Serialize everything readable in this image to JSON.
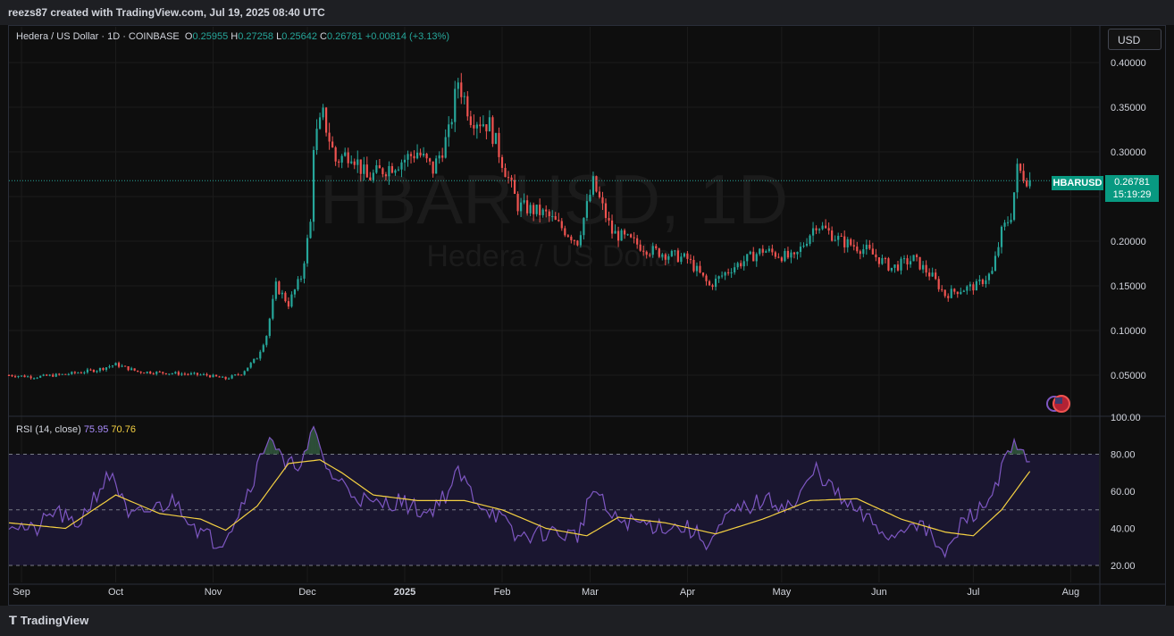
{
  "header": {
    "credit": "reezs87 created with TradingView.com, Jul 19, 2025 08:40 UTC"
  },
  "legend": {
    "title": "Hedera / US Dollar · 1D · COINBASE",
    "o_label": "O",
    "o": "0.25955",
    "h_label": "H",
    "h": "0.27258",
    "l_label": "L",
    "l": "0.25642",
    "c_label": "C",
    "c": "0.26781",
    "change": "+0.00814 (+3.13%)"
  },
  "currency_button": "USD",
  "watermark": {
    "symbol": "HBARUSD, 1D",
    "name": "Hedera / US Dollar"
  },
  "price_tag": {
    "symbol": "HBARUSD",
    "price": "0.26781",
    "countdown": "15:19:29"
  },
  "rsi_legend": {
    "label": "RSI (14, close)",
    "rsi": "75.95",
    "ma": "70.76"
  },
  "footer": {
    "brand": "TradingView"
  },
  "colors": {
    "up": "#26a69a",
    "down": "#ef5350",
    "rsi": "#7e57c2",
    "rsi_ma": "#f5d142",
    "bg": "#0e0e0e"
  },
  "chart_data": [
    {
      "type": "candlestick",
      "title": "Hedera / US Dollar · 1D · COINBASE",
      "x_ticks": [
        "Sep",
        "Oct",
        "Nov",
        "Dec",
        "2025",
        "Feb",
        "Mar",
        "Apr",
        "May",
        "Jun",
        "Jul",
        "Aug"
      ],
      "y_ticks": [
        "0.40000",
        "0.35000",
        "0.30000",
        "0.25000",
        "0.20000",
        "0.15000",
        "0.10000",
        "0.05000"
      ],
      "ylim": [
        0.0,
        0.42
      ],
      "last_price": 0.26781,
      "close_path": [
        {
          "x": "2024-08-28",
          "y": 0.05
        },
        {
          "x": "2024-09-05",
          "y": 0.048
        },
        {
          "x": "2024-09-15",
          "y": 0.051
        },
        {
          "x": "2024-09-25",
          "y": 0.056
        },
        {
          "x": "2024-10-01",
          "y": 0.062
        },
        {
          "x": "2024-10-08",
          "y": 0.054
        },
        {
          "x": "2024-10-20",
          "y": 0.052
        },
        {
          "x": "2024-10-30",
          "y": 0.05
        },
        {
          "x": "2024-11-05",
          "y": 0.046
        },
        {
          "x": "2024-11-10",
          "y": 0.052
        },
        {
          "x": "2024-11-15",
          "y": 0.07
        },
        {
          "x": "2024-11-18",
          "y": 0.095
        },
        {
          "x": "2024-11-21",
          "y": 0.15
        },
        {
          "x": "2024-11-25",
          "y": 0.13
        },
        {
          "x": "2024-11-29",
          "y": 0.16
        },
        {
          "x": "2024-12-02",
          "y": 0.22
        },
        {
          "x": "2024-12-03",
          "y": 0.31
        },
        {
          "x": "2024-12-06",
          "y": 0.34
        },
        {
          "x": "2024-12-10",
          "y": 0.29
        },
        {
          "x": "2024-12-15",
          "y": 0.3
        },
        {
          "x": "2024-12-20",
          "y": 0.27
        },
        {
          "x": "2024-12-25",
          "y": 0.28
        },
        {
          "x": "2024-12-31",
          "y": 0.29
        },
        {
          "x": "2025-01-05",
          "y": 0.3
        },
        {
          "x": "2025-01-10",
          "y": 0.28
        },
        {
          "x": "2025-01-15",
          "y": 0.32
        },
        {
          "x": "2025-01-18",
          "y": 0.38
        },
        {
          "x": "2025-01-22",
          "y": 0.34
        },
        {
          "x": "2025-01-28",
          "y": 0.33
        },
        {
          "x": "2025-02-02",
          "y": 0.28
        },
        {
          "x": "2025-02-06",
          "y": 0.24
        },
        {
          "x": "2025-02-15",
          "y": 0.23
        },
        {
          "x": "2025-02-25",
          "y": 0.2
        },
        {
          "x": "2025-03-02",
          "y": 0.265
        },
        {
          "x": "2025-03-08",
          "y": 0.21
        },
        {
          "x": "2025-03-20",
          "y": 0.19
        },
        {
          "x": "2025-04-01",
          "y": 0.18
        },
        {
          "x": "2025-04-08",
          "y": 0.15
        },
        {
          "x": "2025-04-15",
          "y": 0.17
        },
        {
          "x": "2025-04-25",
          "y": 0.19
        },
        {
          "x": "2025-05-05",
          "y": 0.18
        },
        {
          "x": "2025-05-12",
          "y": 0.22
        },
        {
          "x": "2025-05-20",
          "y": 0.2
        },
        {
          "x": "2025-05-28",
          "y": 0.19
        },
        {
          "x": "2025-06-05",
          "y": 0.17
        },
        {
          "x": "2025-06-12",
          "y": 0.18
        },
        {
          "x": "2025-06-18",
          "y": 0.16
        },
        {
          "x": "2025-06-22",
          "y": 0.14
        },
        {
          "x": "2025-06-26",
          "y": 0.145
        },
        {
          "x": "2025-07-02",
          "y": 0.15
        },
        {
          "x": "2025-07-07",
          "y": 0.165
        },
        {
          "x": "2025-07-10",
          "y": 0.21
        },
        {
          "x": "2025-07-13",
          "y": 0.23
        },
        {
          "x": "2025-07-15",
          "y": 0.28
        },
        {
          "x": "2025-07-19",
          "y": 0.26781
        }
      ]
    },
    {
      "type": "line",
      "title": "RSI (14, close)",
      "y_ticks": [
        "100.00",
        "80.00",
        "60.00",
        "40.00",
        "20.00"
      ],
      "ylim": [
        12,
        100
      ],
      "bands": [
        80,
        50,
        20
      ],
      "series": [
        {
          "name": "RSI",
          "points": [
            {
              "x": "2024-08-28",
              "y": 44
            },
            {
              "x": "2024-09-05",
              "y": 38
            },
            {
              "x": "2024-09-12",
              "y": 50
            },
            {
              "x": "2024-09-18",
              "y": 40
            },
            {
              "x": "2024-09-26",
              "y": 62
            },
            {
              "x": "2024-09-30",
              "y": 70
            },
            {
              "x": "2024-10-05",
              "y": 45
            },
            {
              "x": "2024-10-12",
              "y": 50
            },
            {
              "x": "2024-10-20",
              "y": 55
            },
            {
              "x": "2024-10-28",
              "y": 38
            },
            {
              "x": "2024-11-03",
              "y": 32
            },
            {
              "x": "2024-11-08",
              "y": 45
            },
            {
              "x": "2024-11-14",
              "y": 68
            },
            {
              "x": "2024-11-19",
              "y": 92
            },
            {
              "x": "2024-11-24",
              "y": 72
            },
            {
              "x": "2024-11-30",
              "y": 78
            },
            {
              "x": "2024-12-03",
              "y": 92
            },
            {
              "x": "2024-12-08",
              "y": 70
            },
            {
              "x": "2024-12-15",
              "y": 60
            },
            {
              "x": "2024-12-22",
              "y": 52
            },
            {
              "x": "2024-12-30",
              "y": 55
            },
            {
              "x": "2025-01-08",
              "y": 48
            },
            {
              "x": "2025-01-15",
              "y": 60
            },
            {
              "x": "2025-01-18",
              "y": 70
            },
            {
              "x": "2025-01-24",
              "y": 55
            },
            {
              "x": "2025-02-01",
              "y": 45
            },
            {
              "x": "2025-02-05",
              "y": 35
            },
            {
              "x": "2025-02-15",
              "y": 38
            },
            {
              "x": "2025-02-25",
              "y": 36
            },
            {
              "x": "2025-03-02",
              "y": 62
            },
            {
              "x": "2025-03-08",
              "y": 45
            },
            {
              "x": "2025-03-20",
              "y": 42
            },
            {
              "x": "2025-04-01",
              "y": 40
            },
            {
              "x": "2025-04-08",
              "y": 32
            },
            {
              "x": "2025-04-15",
              "y": 48
            },
            {
              "x": "2025-04-25",
              "y": 55
            },
            {
              "x": "2025-05-05",
              "y": 52
            },
            {
              "x": "2025-05-12",
              "y": 72
            },
            {
              "x": "2025-05-20",
              "y": 55
            },
            {
              "x": "2025-05-28",
              "y": 45
            },
            {
              "x": "2025-06-05",
              "y": 35
            },
            {
              "x": "2025-06-12",
              "y": 45
            },
            {
              "x": "2025-06-18",
              "y": 35
            },
            {
              "x": "2025-06-22",
              "y": 24
            },
            {
              "x": "2025-06-28",
              "y": 45
            },
            {
              "x": "2025-07-05",
              "y": 52
            },
            {
              "x": "2025-07-10",
              "y": 72
            },
            {
              "x": "2025-07-14",
              "y": 84
            },
            {
              "x": "2025-07-17",
              "y": 78
            },
            {
              "x": "2025-07-19",
              "y": 75.95
            }
          ]
        },
        {
          "name": "RSI MA",
          "points": [
            {
              "x": "2024-08-28",
              "y": 43
            },
            {
              "x": "2024-09-15",
              "y": 40
            },
            {
              "x": "2024-10-01",
              "y": 58
            },
            {
              "x": "2024-10-15",
              "y": 48
            },
            {
              "x": "2024-10-28",
              "y": 45
            },
            {
              "x": "2024-11-05",
              "y": 39
            },
            {
              "x": "2024-11-15",
              "y": 52
            },
            {
              "x": "2024-11-25",
              "y": 75
            },
            {
              "x": "2024-12-05",
              "y": 77
            },
            {
              "x": "2024-12-12",
              "y": 70
            },
            {
              "x": "2024-12-22",
              "y": 58
            },
            {
              "x": "2025-01-05",
              "y": 55
            },
            {
              "x": "2025-01-20",
              "y": 55
            },
            {
              "x": "2025-02-01",
              "y": 50
            },
            {
              "x": "2025-02-15",
              "y": 40
            },
            {
              "x": "2025-02-28",
              "y": 36
            },
            {
              "x": "2025-03-10",
              "y": 46
            },
            {
              "x": "2025-03-25",
              "y": 43
            },
            {
              "x": "2025-04-10",
              "y": 37
            },
            {
              "x": "2025-04-25",
              "y": 45
            },
            {
              "x": "2025-05-10",
              "y": 55
            },
            {
              "x": "2025-05-25",
              "y": 56
            },
            {
              "x": "2025-06-08",
              "y": 45
            },
            {
              "x": "2025-06-22",
              "y": 38
            },
            {
              "x": "2025-07-01",
              "y": 36
            },
            {
              "x": "2025-07-10",
              "y": 50
            },
            {
              "x": "2025-07-19",
              "y": 70.76
            }
          ]
        }
      ]
    }
  ]
}
